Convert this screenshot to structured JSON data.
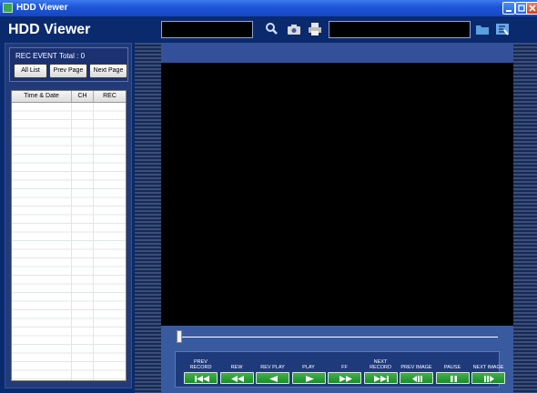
{
  "window": {
    "title": "HDD Viewer"
  },
  "header": {
    "app_title": "HDD Viewer"
  },
  "left_panel": {
    "rec_event_label": "REC EVENT",
    "total_text": "Total : 0",
    "buttons": {
      "all_list": "All List",
      "prev_page": "Prev Page",
      "next_page": "Next Page"
    },
    "table": {
      "columns": [
        "Time & Date",
        "CH",
        "REC"
      ],
      "rows": []
    }
  },
  "toolbar": {
    "icons": [
      "search-icon",
      "camera-icon",
      "print-icon",
      "folder-icon",
      "settings-icon"
    ]
  },
  "playback": {
    "seek_position": 0,
    "controls": [
      {
        "label": "PREV\nRECORD",
        "icon": "skip-back-icon"
      },
      {
        "label": "REW",
        "icon": "rewind-icon"
      },
      {
        "label": "REV PLAY",
        "icon": "reverse-play-icon"
      },
      {
        "label": "PLAY",
        "icon": "play-icon"
      },
      {
        "label": "FF",
        "icon": "fast-forward-icon"
      },
      {
        "label": "NEXT\nRECORD",
        "icon": "skip-forward-icon"
      },
      {
        "label": "PREV IMAGE",
        "icon": "prev-image-icon"
      },
      {
        "label": "PAUSE",
        "icon": "pause-icon"
      },
      {
        "label": "NEXT IMAGE",
        "icon": "next-image-icon"
      }
    ]
  },
  "colors": {
    "accent_green": "#2a9a38",
    "background": "#0a2a6e",
    "video": "#000000"
  }
}
